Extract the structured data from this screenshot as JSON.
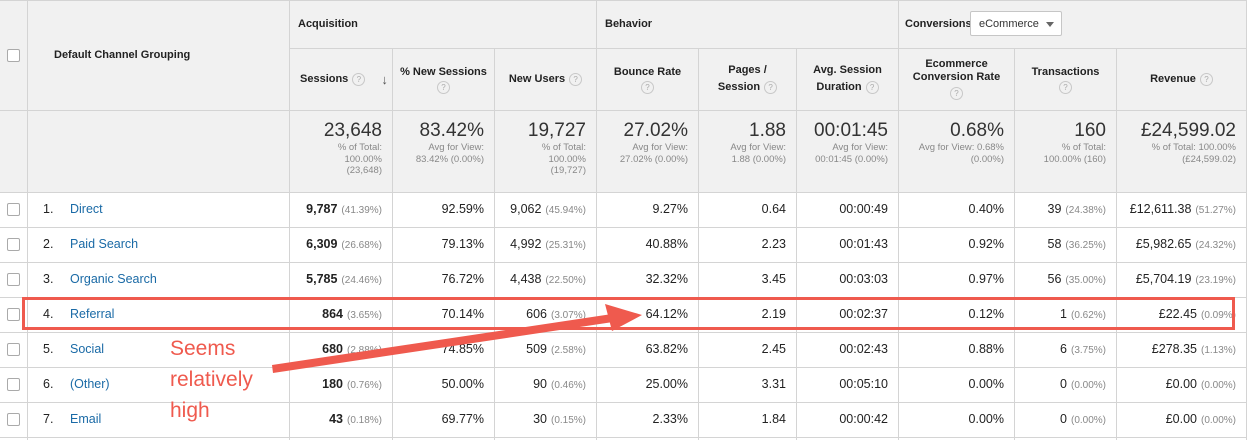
{
  "colors": {
    "accent_red": "#ef5a4e",
    "link_blue": "#1a6aa6",
    "header_bg": "#f1f1f1",
    "grid": "#d4d4d4"
  },
  "groups": {
    "acquisition": "Acquisition",
    "behavior": "Behavior",
    "conversions": "Conversions",
    "conversions_select": "eCommerce"
  },
  "columns": {
    "channel": "Default Channel Grouping",
    "sessions": "Sessions",
    "new_sessions": "% New Sessions",
    "new_users": "New Users",
    "bounce_rate": "Bounce Rate",
    "pages_session_1": "Pages /",
    "pages_session_2": "Session",
    "avg_duration_1": "Avg. Session",
    "avg_duration_2": "Duration",
    "conv_rate_1": "Ecommerce",
    "conv_rate_2": "Conversion Rate",
    "transactions": "Transactions",
    "revenue": "Revenue"
  },
  "icons": {
    "help": "?",
    "sort": "↓"
  },
  "totals": {
    "sessions": {
      "value": "23,648",
      "l1": "% of Total:",
      "l2": "100.00%",
      "l3": "(23,648)"
    },
    "new_sessions": {
      "value": "83.42%",
      "l1": "Avg for View:",
      "l2": "83.42% (0.00%)"
    },
    "new_users": {
      "value": "19,727",
      "l1": "% of Total:",
      "l2": "100.00%",
      "l3": "(19,727)"
    },
    "bounce_rate": {
      "value": "27.02%",
      "l1": "Avg for View:",
      "l2": "27.02% (0.00%)"
    },
    "pages_session": {
      "value": "1.88",
      "l1": "Avg for View:",
      "l2": "1.88 (0.00%)"
    },
    "avg_duration": {
      "value": "00:01:45",
      "l1": "Avg for View:",
      "l2": "00:01:45 (0.00%)"
    },
    "conv_rate": {
      "value": "0.68%",
      "l1": "Avg for View: 0.68%",
      "l2": "(0.00%)"
    },
    "transactions": {
      "value": "160",
      "l1": "% of Total:",
      "l2": "100.00% (160)"
    },
    "revenue": {
      "value": "£24,599.02",
      "l1": "% of Total: 100.00%",
      "l2": "(£24,599.02)"
    }
  },
  "rows": [
    {
      "idx": "1.",
      "channel": "Direct",
      "sessions": "9,787",
      "sessions_pct": "(41.39%)",
      "new_sessions": "92.59%",
      "new_users": "9,062",
      "new_users_pct": "(45.94%)",
      "bounce": "9.27%",
      "pages": "0.64",
      "duration": "00:00:49",
      "conv": "0.40%",
      "trans": "39",
      "trans_pct": "(24.38%)",
      "revenue": "£12,611.38",
      "revenue_pct": "(51.27%)"
    },
    {
      "idx": "2.",
      "channel": "Paid Search",
      "sessions": "6,309",
      "sessions_pct": "(26.68%)",
      "new_sessions": "79.13%",
      "new_users": "4,992",
      "new_users_pct": "(25.31%)",
      "bounce": "40.88%",
      "pages": "2.23",
      "duration": "00:01:43",
      "conv": "0.92%",
      "trans": "58",
      "trans_pct": "(36.25%)",
      "revenue": "£5,982.65",
      "revenue_pct": "(24.32%)"
    },
    {
      "idx": "3.",
      "channel": "Organic Search",
      "sessions": "5,785",
      "sessions_pct": "(24.46%)",
      "new_sessions": "76.72%",
      "new_users": "4,438",
      "new_users_pct": "(22.50%)",
      "bounce": "32.32%",
      "pages": "3.45",
      "duration": "00:03:03",
      "conv": "0.97%",
      "trans": "56",
      "trans_pct": "(35.00%)",
      "revenue": "£5,704.19",
      "revenue_pct": "(23.19%)"
    },
    {
      "idx": "4.",
      "channel": "Referral",
      "sessions": "864",
      "sessions_pct": "(3.65%)",
      "new_sessions": "70.14%",
      "new_users": "606",
      "new_users_pct": "(3.07%)",
      "bounce": "64.12%",
      "pages": "2.19",
      "duration": "00:02:37",
      "conv": "0.12%",
      "trans": "1",
      "trans_pct": "(0.62%)",
      "revenue": "£22.45",
      "revenue_pct": "(0.09%)"
    },
    {
      "idx": "5.",
      "channel": "Social",
      "sessions": "680",
      "sessions_pct": "(2.88%)",
      "new_sessions": "74.85%",
      "new_users": "509",
      "new_users_pct": "(2.58%)",
      "bounce": "63.82%",
      "pages": "2.45",
      "duration": "00:02:43",
      "conv": "0.88%",
      "trans": "6",
      "trans_pct": "(3.75%)",
      "revenue": "£278.35",
      "revenue_pct": "(1.13%)"
    },
    {
      "idx": "6.",
      "channel": "(Other)",
      "sessions": "180",
      "sessions_pct": "(0.76%)",
      "new_sessions": "50.00%",
      "new_users": "90",
      "new_users_pct": "(0.46%)",
      "bounce": "25.00%",
      "pages": "3.31",
      "duration": "00:05:10",
      "conv": "0.00%",
      "trans": "0",
      "trans_pct": "(0.00%)",
      "revenue": "£0.00",
      "revenue_pct": "(0.00%)"
    },
    {
      "idx": "7.",
      "channel": "Email",
      "sessions": "43",
      "sessions_pct": "(0.18%)",
      "new_sessions": "69.77%",
      "new_users": "30",
      "new_users_pct": "(0.15%)",
      "bounce": "2.33%",
      "pages": "1.84",
      "duration": "00:00:42",
      "conv": "0.00%",
      "trans": "0",
      "trans_pct": "(0.00%)",
      "revenue": "£0.00",
      "revenue_pct": "(0.00%)"
    }
  ],
  "annotation": {
    "l1": "Seems",
    "l2": "relatively",
    "l3": "high"
  }
}
